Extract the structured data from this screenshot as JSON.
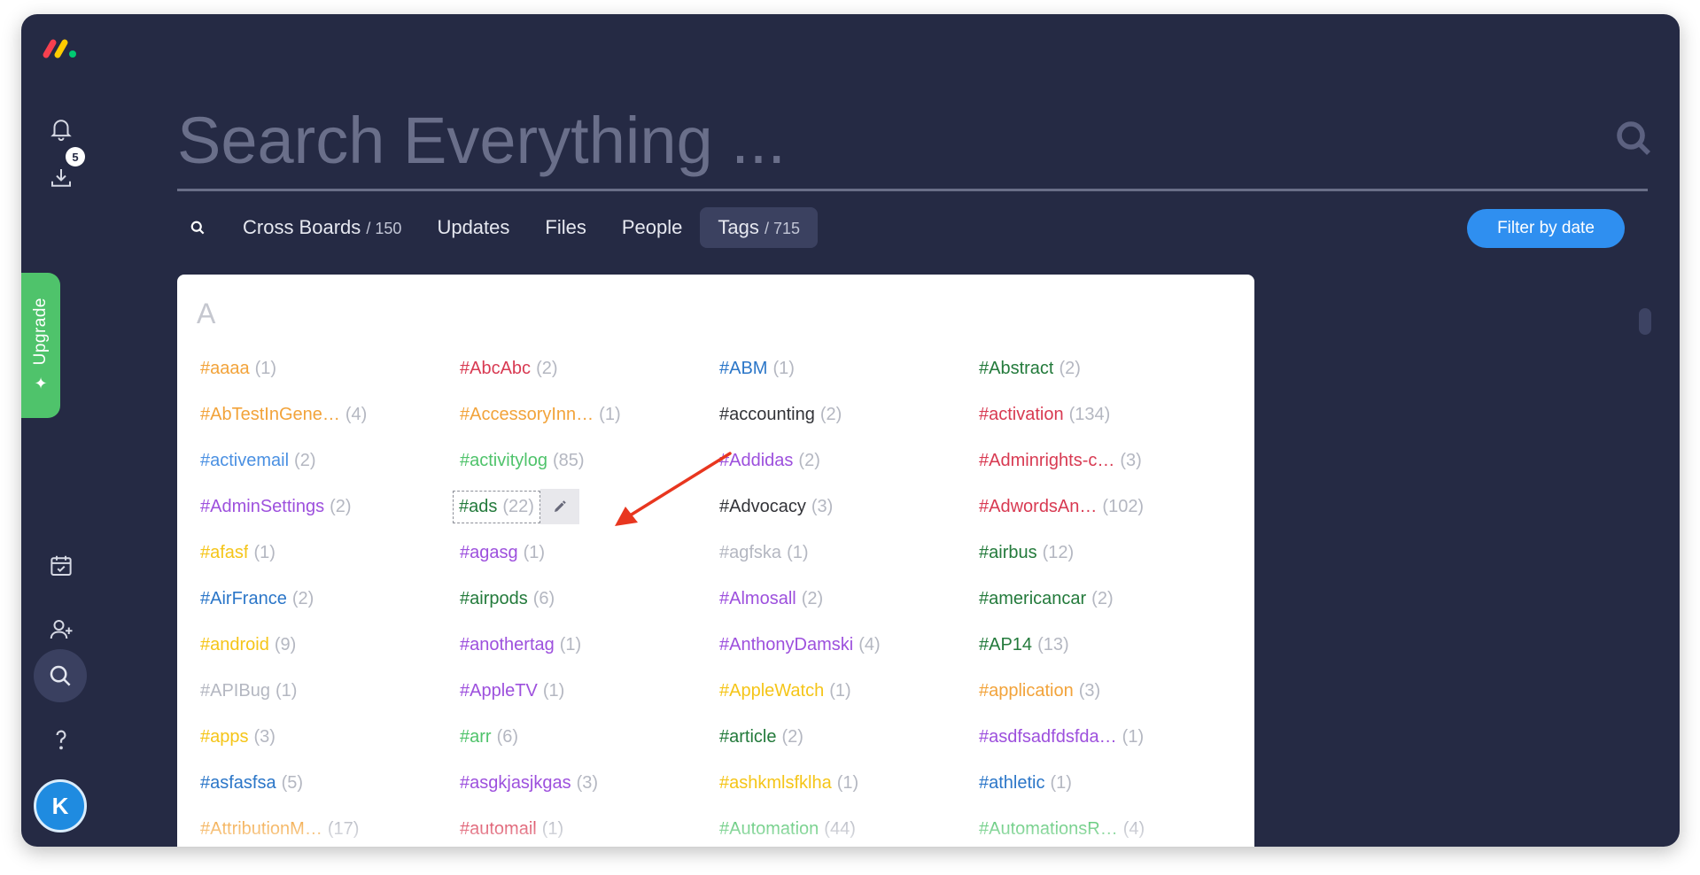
{
  "header": {
    "search_placeholder": "Search Everything ...",
    "filter_label": "Filter by date"
  },
  "sidebar": {
    "inbox_badge": "5",
    "upgrade_label": "Upgrade",
    "avatar_initial": "K"
  },
  "tabs": [
    {
      "label": "Cross Boards",
      "count": "/ 150"
    },
    {
      "label": "Updates",
      "count": ""
    },
    {
      "label": "Files",
      "count": ""
    },
    {
      "label": "People",
      "count": ""
    },
    {
      "label": "Tags",
      "count": "/ 715",
      "active": true
    }
  ],
  "panel": {
    "section_letter": "A",
    "tags": [
      {
        "name": "#aaaa",
        "count": "(1)",
        "color": "#f2a33a"
      },
      {
        "name": "#AbcAbc",
        "count": "(2)",
        "color": "#d83a52"
      },
      {
        "name": "#ABM",
        "count": "(1)",
        "color": "#2b76c8"
      },
      {
        "name": "#Abstract",
        "count": "(2)",
        "color": "#237a3b"
      },
      {
        "name": "#AbTestInGene…",
        "count": "(4)",
        "color": "#f2a33a"
      },
      {
        "name": "#AccessoryInn…",
        "count": "(1)",
        "color": "#f2a33a"
      },
      {
        "name": "#accounting",
        "count": "(2)",
        "color": "#323338"
      },
      {
        "name": "#activation",
        "count": "(134)",
        "color": "#d83a52"
      },
      {
        "name": "#activemail",
        "count": "(2)",
        "color": "#4a90e2"
      },
      {
        "name": "#activitylog",
        "count": "(85)",
        "color": "#4fc36b"
      },
      {
        "name": "#Addidas",
        "count": "(2)",
        "color": "#9d50dd"
      },
      {
        "name": "#Adminrights-c…",
        "count": "(3)",
        "color": "#d83a52"
      },
      {
        "name": "#AdminSettings",
        "count": "(2)",
        "color": "#9d50dd"
      },
      {
        "name": "#ads",
        "count": "(22)",
        "color": "#237a3b",
        "highlight": true
      },
      {
        "name": "#Advocacy",
        "count": "(3)",
        "color": "#323338"
      },
      {
        "name": "#AdwordsAn…",
        "count": "(102)",
        "color": "#d83a52"
      },
      {
        "name": "#afasf",
        "count": "(1)",
        "color": "#f5c518"
      },
      {
        "name": "#agasg",
        "count": "(1)",
        "color": "#9d50dd"
      },
      {
        "name": "#agfska",
        "count": "(1)",
        "color": "#b4b7c1"
      },
      {
        "name": "#airbus",
        "count": "(12)",
        "color": "#237a3b"
      },
      {
        "name": "#AirFrance",
        "count": "(2)",
        "color": "#2b76c8"
      },
      {
        "name": "#airpods",
        "count": "(6)",
        "color": "#237a3b"
      },
      {
        "name": "#Almosall",
        "count": "(2)",
        "color": "#9d50dd"
      },
      {
        "name": "#americancar",
        "count": "(2)",
        "color": "#237a3b"
      },
      {
        "name": "#android",
        "count": "(9)",
        "color": "#f5c518"
      },
      {
        "name": "#anothertag",
        "count": "(1)",
        "color": "#9d50dd"
      },
      {
        "name": "#AnthonyDamski",
        "count": "(4)",
        "color": "#9d50dd"
      },
      {
        "name": "#AP14",
        "count": "(13)",
        "color": "#237a3b"
      },
      {
        "name": "#APIBug",
        "count": "(1)",
        "color": "#b4b7c1"
      },
      {
        "name": "#AppleTV",
        "count": "(1)",
        "color": "#9d50dd"
      },
      {
        "name": "#AppleWatch",
        "count": "(1)",
        "color": "#f5c518"
      },
      {
        "name": "#application",
        "count": "(3)",
        "color": "#f2a33a"
      },
      {
        "name": "#apps",
        "count": "(3)",
        "color": "#f5c518"
      },
      {
        "name": "#arr",
        "count": "(6)",
        "color": "#4fc36b"
      },
      {
        "name": "#article",
        "count": "(2)",
        "color": "#237a3b"
      },
      {
        "name": "#asdfsadfdsfda…",
        "count": "(1)",
        "color": "#9d50dd"
      },
      {
        "name": "#asfasfsa",
        "count": "(5)",
        "color": "#2b76c8"
      },
      {
        "name": "#asgkjasjkgas",
        "count": "(3)",
        "color": "#9d50dd"
      },
      {
        "name": "#ashkmlsfklha",
        "count": "(1)",
        "color": "#f5c518"
      },
      {
        "name": "#athletic",
        "count": "(1)",
        "color": "#2b76c8"
      },
      {
        "name": "#AttributionM…",
        "count": "(17)",
        "color": "#f2a33a"
      },
      {
        "name": "#automail",
        "count": "(1)",
        "color": "#d83a52"
      },
      {
        "name": "#Automation",
        "count": "(44)",
        "color": "#4fc36b"
      },
      {
        "name": "#AutomationsR…",
        "count": "(4)",
        "color": "#4fc36b"
      }
    ]
  }
}
